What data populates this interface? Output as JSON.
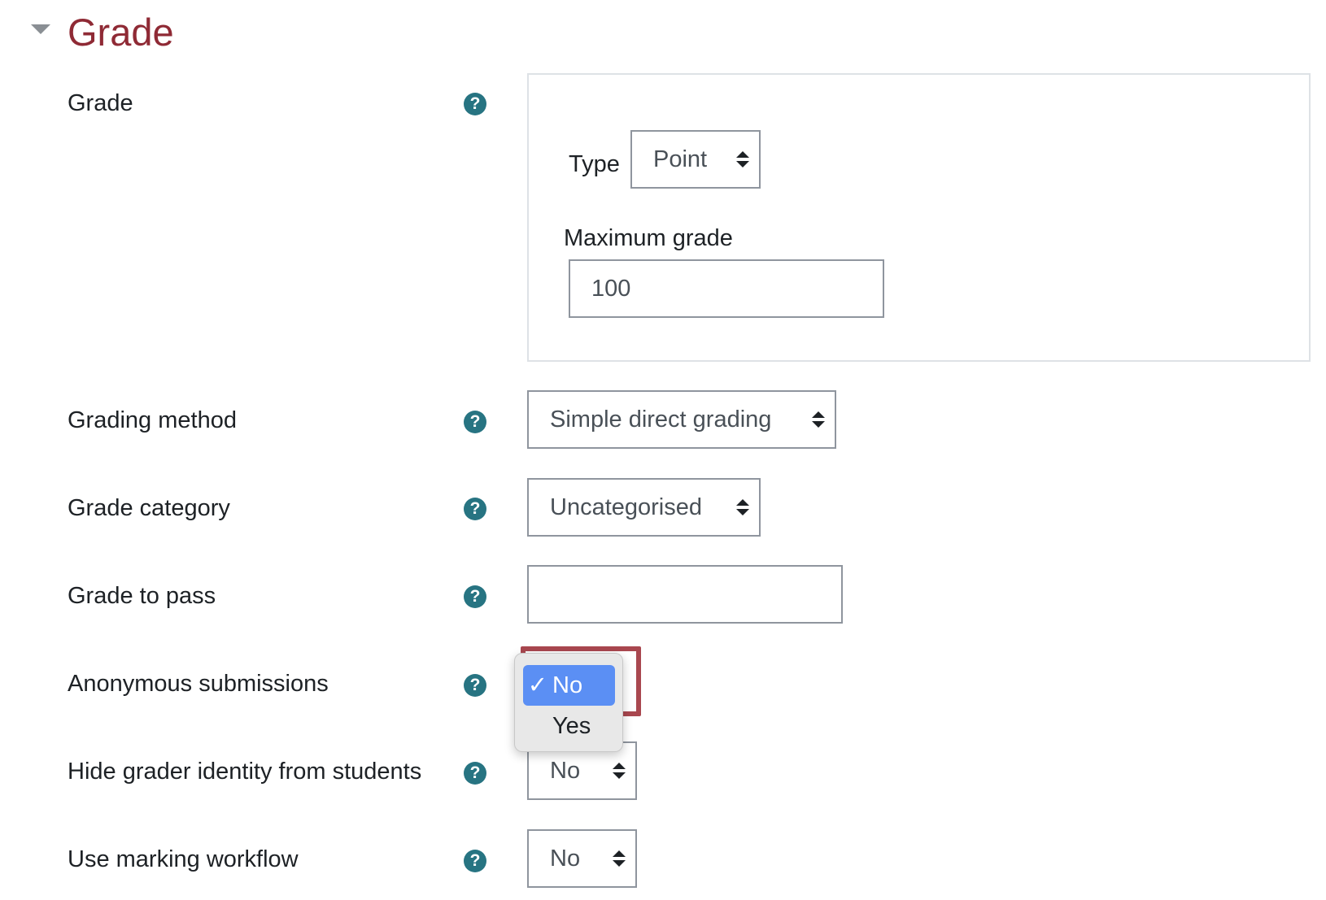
{
  "section": {
    "title": "Grade"
  },
  "grade": {
    "label": "Grade",
    "type_label": "Type",
    "type_value": "Point",
    "max_grade_label": "Maximum grade",
    "max_grade_value": "100"
  },
  "grading_method": {
    "label": "Grading method",
    "value": "Simple direct grading"
  },
  "grade_category": {
    "label": "Grade category",
    "value": "Uncategorised"
  },
  "grade_to_pass": {
    "label": "Grade to pass",
    "value": ""
  },
  "anonymous_submissions": {
    "label": "Anonymous submissions",
    "selected": "No",
    "options": [
      "No",
      "Yes"
    ],
    "check_mark": "✓"
  },
  "hide_grader": {
    "label": "Hide grader identity from students",
    "value": "No"
  },
  "marking_workflow": {
    "label": "Use marking workflow",
    "value": "No"
  },
  "help_icon_glyph": "?",
  "colors": {
    "section_title": "#8f2a35",
    "help_icon": "#277482",
    "focus_border": "#a9474f",
    "selected_option": "#5b8ff4"
  }
}
